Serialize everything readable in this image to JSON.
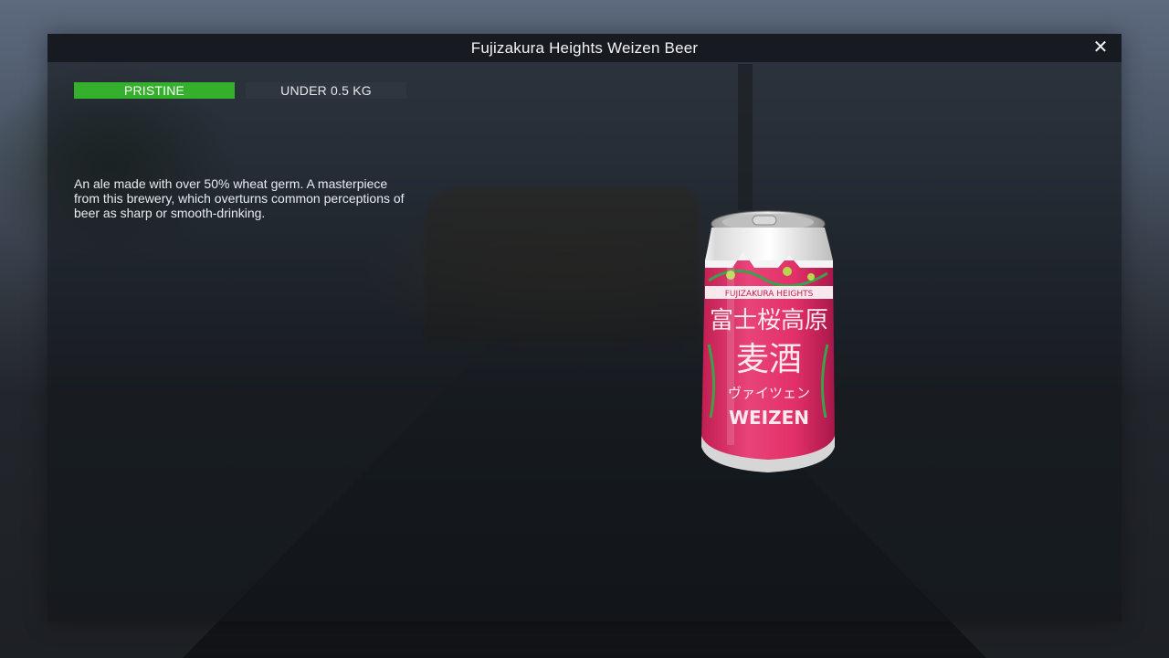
{
  "window": {
    "title": "Fujizakura Heights Weizen Beer",
    "close_icon": "close-icon"
  },
  "tags": {
    "condition": "PRISTINE",
    "weight": "UNDER 0.5 KG"
  },
  "item": {
    "description": "An ale made with over 50% wheat germ. A masterpiece from this brewery, which overturns common perceptions of beer as sharp or smooth-drinking.",
    "image_icon": "beer-can-image",
    "can_text": {
      "brand_line": "FUJIZAKURA HEIGHTS",
      "kanji_top": "富士桜高原",
      "kanji_mid": "麦酒",
      "katakana": "ヴァイツェン",
      "style": "WEIZEN"
    }
  },
  "colors": {
    "condition_tag": "#35b02c",
    "can_pink": "#e2326a",
    "panel": "#12161c"
  }
}
